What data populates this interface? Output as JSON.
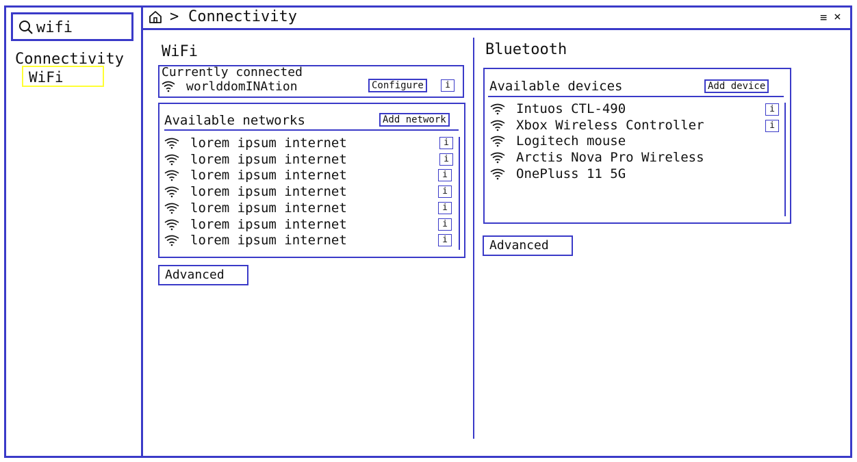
{
  "sidebar": {
    "search": {
      "value": "wifi"
    },
    "section_label": "Connectivity",
    "selected_item": "WiFi"
  },
  "header": {
    "breadcrumb_separator": ">",
    "title": "Connectivity",
    "menu_glyph": "≡",
    "close_glyph": "×"
  },
  "wifi": {
    "title": "WiFi",
    "current": {
      "heading": "Currently connected",
      "network": "worlddomINAtion",
      "configure_label": "Configure",
      "info_label": "i"
    },
    "available": {
      "heading": "Available networks",
      "add_label": "Add network",
      "info_label": "i",
      "networks": [
        "lorem ipsum internet",
        "lorem ipsum internet",
        "lorem ipsum internet",
        "lorem ipsum internet",
        "lorem ipsum internet",
        "lorem ipsum internet",
        "lorem ipsum internet"
      ]
    },
    "advanced_label": "Advanced"
  },
  "bluetooth": {
    "title": "Bluetooth",
    "heading": "Available devices",
    "add_label": "Add device",
    "info_label": "i",
    "devices": [
      "Intuos CTL-490",
      "Xbox Wireless Controller",
      "Logitech mouse",
      "Arctis Nova Pro Wireless",
      "OnePluss 11 5G"
    ],
    "advanced_label": "Advanced"
  },
  "colors": {
    "accent": "#3a3ac8",
    "selection": "#ffff33"
  },
  "icons": {
    "search": "search-icon",
    "home": "home-icon",
    "signal": "wifi-icon"
  }
}
